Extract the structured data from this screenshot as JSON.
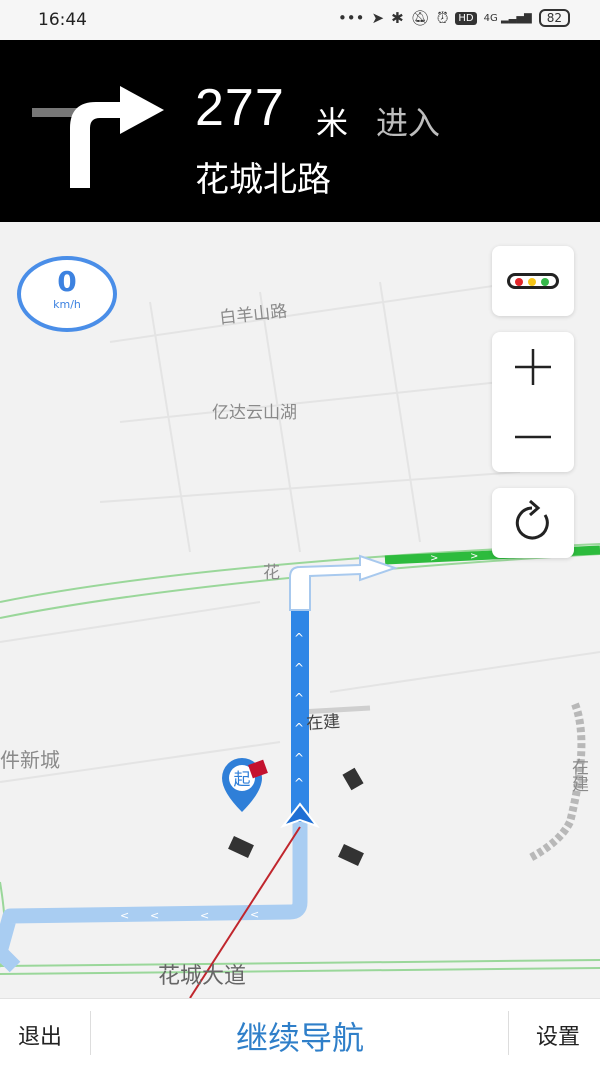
{
  "status_bar": {
    "time": "16:44",
    "icons": [
      "more-dots-icon",
      "location-icon",
      "bluetooth-icon",
      "mute-bell-icon",
      "alarm-icon",
      "hd-icon",
      "signal-4g-icon"
    ],
    "hd": "HD",
    "network": "4G",
    "battery": "82"
  },
  "navigation": {
    "distance": "277",
    "unit": "米",
    "action": "进入",
    "road": "花城北路"
  },
  "speed": {
    "value": "0",
    "unit": "km/h"
  },
  "map": {
    "labels": {
      "baiyang_road": "白羊山路",
      "yida": "亿达云山湖",
      "huacheng_road_partial": "花",
      "construction_1": "在建",
      "software_town_partial": "件新城",
      "construction_2": "在建",
      "huacheng_avenue": "花城大道",
      "start_marker": "起"
    },
    "route_color": "#2f86e6",
    "traffic_green": "#2dbb3d"
  },
  "bottom_bar": {
    "exit": "退出",
    "continue": "继续导航",
    "settings": "设置"
  }
}
